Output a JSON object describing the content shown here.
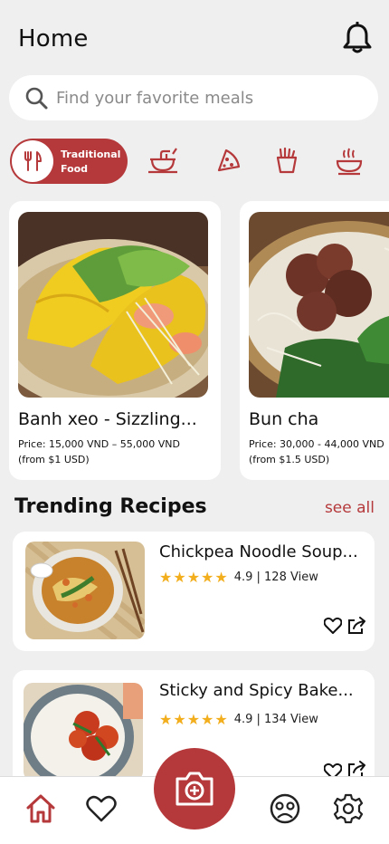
{
  "header": {
    "title": "Home"
  },
  "search": {
    "placeholder": "Find your favorite meals"
  },
  "categories": {
    "active": {
      "label": "Traditional Food"
    },
    "items": [
      "bowl-icon",
      "pizza-icon",
      "fries-icon",
      "ramen-icon"
    ]
  },
  "featured": [
    {
      "name": "Banh xeo - Sizzling...",
      "price": "Price: 15,000 VND – 55,000 VND",
      "usd": "(from $1 USD)"
    },
    {
      "name": "Bun cha",
      "price": "Price: 30,000 - 44,000 VND",
      "usd": "(from $1.5 USD)"
    }
  ],
  "trending": {
    "title": "Trending Recipes",
    "see_all": "see all",
    "items": [
      {
        "name": "Chickpea Noodle Soup...",
        "stars": "★★★★★",
        "meta": "4.9 | 128 View"
      },
      {
        "name": "Sticky and Spicy Bake...",
        "stars": "★★★★★",
        "meta": "4.9 | 134 View"
      }
    ]
  },
  "colors": {
    "accent": "#b5393b",
    "star": "#f2ae1c",
    "background": "#efefef"
  }
}
